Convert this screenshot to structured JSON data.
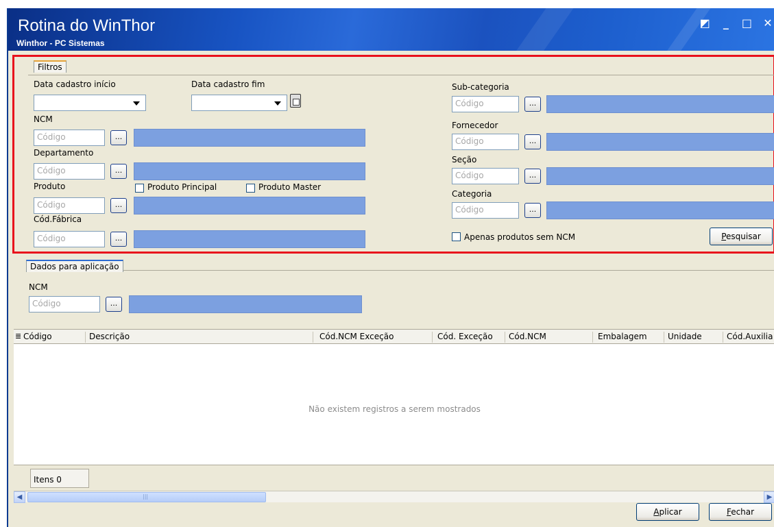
{
  "window": {
    "title": "Rotina do WinThor",
    "subtitle": "Winthor - PC Sistemas",
    "controls": [
      "◩",
      "_",
      "□",
      "✕"
    ]
  },
  "filtros": {
    "tab_label": "Filtros",
    "data_inicio_label": "Data cadastro início",
    "data_fim_label": "Data cadastro fim",
    "ncm_label": "NCM",
    "departamento_label": "Departamento",
    "produto_label": "Produto",
    "produto_principal_label": "Produto Principal",
    "produto_master_label": "Produto Master",
    "cod_fabrica_label": "Cód.Fábrica",
    "subcategoria_label": "Sub-categoria",
    "fornecedor_label": "Fornecedor",
    "secao_label": "Seção",
    "categoria_label": "Categoria",
    "apenas_sem_ncm_label": "Apenas produtos sem NCM",
    "pesquisar_label": "Pesquisar",
    "codigo_placeholder": "Código",
    "dots_label": "..."
  },
  "dados": {
    "tab_label": "Dados para aplicação",
    "ncm_label": "NCM",
    "codigo_placeholder": "Código",
    "dots_label": "..."
  },
  "grid": {
    "columns": [
      "Código",
      "Descrição",
      "Cód.NCM Exceção",
      "Cód. Exceção",
      "Cód.NCM",
      "Embalagem",
      "Unidade",
      "Cód.Auxilia"
    ],
    "empty_message": "Não existem registros a serem mostrados"
  },
  "status": {
    "items_text": "Itens 0"
  },
  "footer": {
    "aplicar_label": "Aplicar",
    "fechar_label": "Fechar"
  }
}
